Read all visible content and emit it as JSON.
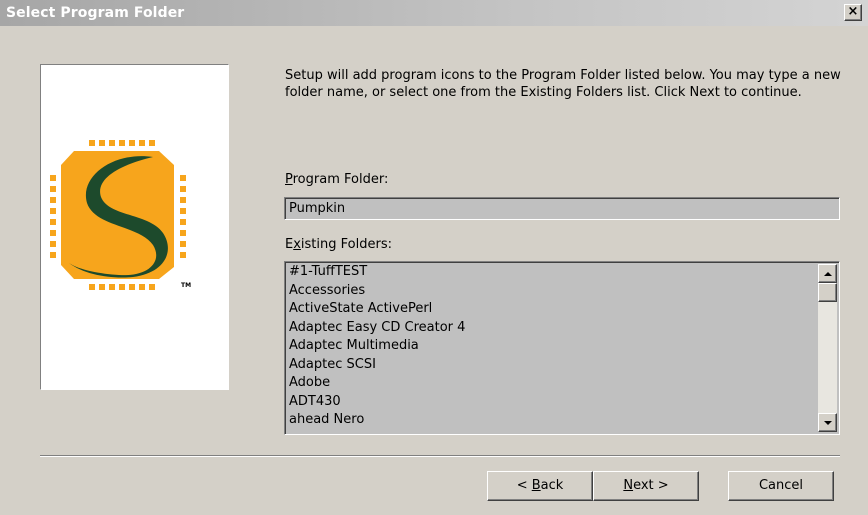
{
  "window": {
    "title": "Select Program Folder",
    "close_glyph": "×"
  },
  "intro": {
    "text": "Setup will add program icons to the Program Folder listed below. You may type a new folder name, or select one from the Existing Folders list. Click Next to continue."
  },
  "program_folder": {
    "label_prefix": "",
    "label_hotkey": "P",
    "label_rest": "rogram Folder:",
    "value": "Pumpkin"
  },
  "existing_folders": {
    "label_prefix": "E",
    "label_hotkey": "x",
    "label_rest": "isting Folders:",
    "items": [
      "#1-TuffTEST",
      "Accessories",
      "ActiveState ActivePerl",
      "Adaptec Easy CD Creator 4",
      "Adaptec Multimedia",
      "Adaptec SCSI",
      "Adobe",
      "ADT430",
      "ahead Nero"
    ]
  },
  "buttons": {
    "back_prefix": "< ",
    "back_hotkey": "B",
    "back_rest": "ack",
    "next_hotkey": "N",
    "next_rest": "ext >",
    "cancel_label": "Cancel"
  },
  "logo": {
    "trademark": "TM",
    "colors": {
      "orange": "#f7a51c",
      "green": "#1d4a2c"
    }
  },
  "icons": {
    "close": "close-icon",
    "scroll_up": "arrow-up-icon",
    "scroll_down": "arrow-down-icon"
  }
}
